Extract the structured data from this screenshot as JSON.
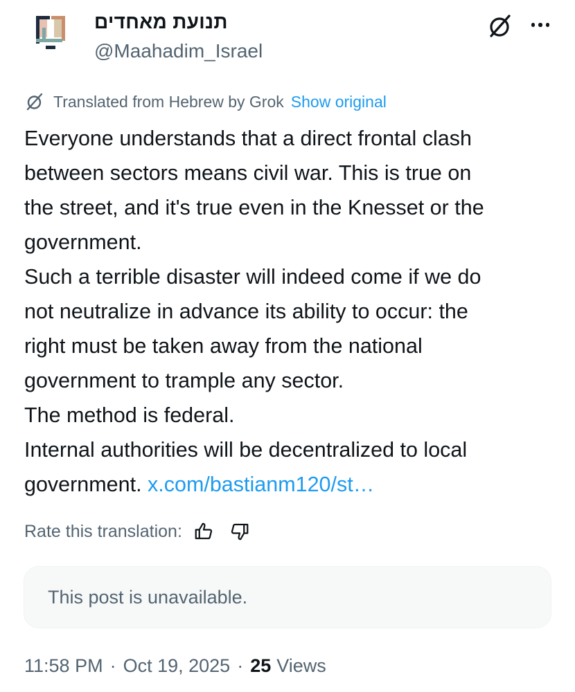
{
  "author": {
    "display_name": "תנועת מאחדים",
    "handle": "@Maahadim_Israel",
    "avatar_icon": "maahadim-logo",
    "logo_colors": [
      "#1e2b3c",
      "#c98f6d",
      "#7da7a2",
      "#c5b49a"
    ]
  },
  "header_icons": [
    "grok-icon",
    "more-icon"
  ],
  "translation": {
    "notice": "Translated from Hebrew by Grok",
    "show_original": "Show original",
    "icon": "grok-icon"
  },
  "body": {
    "lines": [
      "Everyone understands that a direct frontal clash",
      "between sectors means civil war. This is true on",
      "the street, and it's true even in the Knesset or the",
      "government.",
      "Such a terrible disaster will indeed come if we do",
      "not neutralize in advance its ability to occur: the",
      "right must be taken away from the national",
      "government to trample any sector.",
      "The method is federal.",
      "Internal authorities will be decentralized to local"
    ],
    "last_line_text": "government.",
    "link": "x.com/bastianm120/st…"
  },
  "rate": {
    "label": "Rate this translation:",
    "up_icon": "thumbs-up-icon",
    "down_icon": "thumbs-down-icon"
  },
  "quoted": {
    "unavailable_text": "This post is unavailable."
  },
  "meta": {
    "time": "11:58 PM",
    "date": "Oct 19, 2025",
    "separator": "·",
    "views_count": "25",
    "views_label": "Views"
  },
  "colors": {
    "text": "#0f1419",
    "secondary": "#536471",
    "link": "#1d9bf0",
    "box_bg": "#f7f9f9"
  }
}
